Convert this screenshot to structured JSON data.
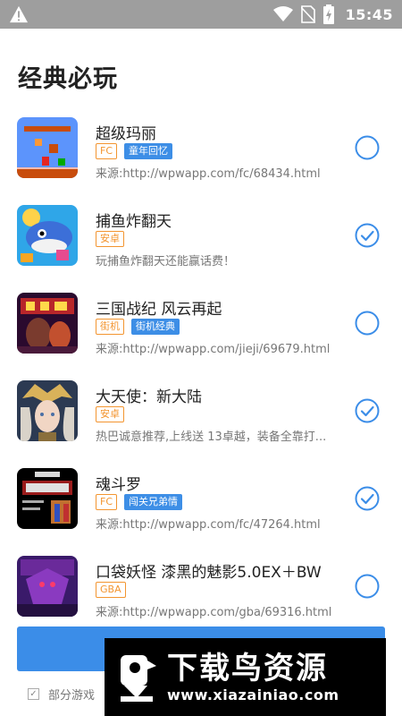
{
  "status_bar": {
    "time": "15:45",
    "icons": [
      "warning-icon",
      "wifi-icon",
      "no-sim-icon",
      "battery-charging-icon"
    ]
  },
  "page": {
    "title": "经典必玩"
  },
  "games": [
    {
      "name": "超级玛丽",
      "tags": [
        {
          "label": "FC",
          "style": "orange"
        },
        {
          "label": "童年回忆",
          "style": "blue"
        }
      ],
      "desc": "来源:http://wpwapp.com/fc/68434.html",
      "checked": false
    },
    {
      "name": "捕鱼炸翻天",
      "tags": [
        {
          "label": "安卓",
          "style": "orange"
        }
      ],
      "desc": "玩捕鱼炸翻天还能赢话费！",
      "checked": true
    },
    {
      "name": "三国战纪 风云再起",
      "tags": [
        {
          "label": "街机",
          "style": "orange"
        },
        {
          "label": "街机经典",
          "style": "blue"
        }
      ],
      "desc": "来源:http://wpwapp.com/jieji/69679.html",
      "checked": false
    },
    {
      "name": "大天使：新大陆",
      "tags": [
        {
          "label": "安卓",
          "style": "orange"
        }
      ],
      "desc": "热巴诚意推荐,上线送 13卓越，装备全靠打...",
      "checked": true
    },
    {
      "name": "魂斗罗",
      "tags": [
        {
          "label": "FC",
          "style": "orange"
        },
        {
          "label": "闯关兄弟情",
          "style": "blue"
        }
      ],
      "desc": "来源:http://wpwapp.com/fc/47264.html",
      "checked": true
    },
    {
      "name": "口袋妖怪 漆黑的魅影5.0EX＋BW",
      "tags": [
        {
          "label": "GBA",
          "style": "orange"
        }
      ],
      "desc": "来源:http://wpwapp.com/gba/69316.html",
      "checked": false
    }
  ],
  "footer": {
    "consent_text": "部分游戏"
  },
  "watermark": {
    "title": "下载鸟资源",
    "url": "www.xiazainiao.com"
  },
  "colors": {
    "accent": "#3b8de8",
    "tag_orange": "#f39530",
    "tag_blue": "#3d8ee6",
    "status_bar": "#9e9e9e"
  }
}
